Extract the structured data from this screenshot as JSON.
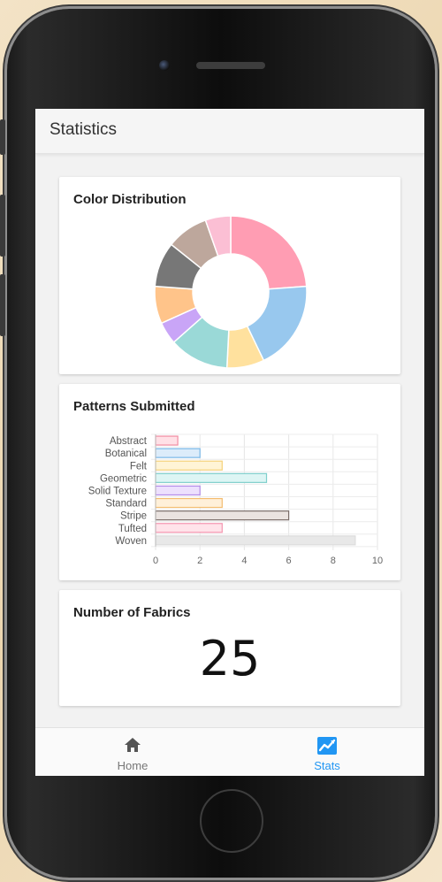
{
  "app": {
    "title": "Statistics"
  },
  "colors": {
    "accent": "#2196f3",
    "nav_inactive": "#777777",
    "pink": "#ff9db3",
    "blue": "#98c8ee",
    "yellow": "#ffe19e",
    "teal": "#9ad9d7",
    "purple": "#c9a5f7",
    "orange": "#ffc48a",
    "gray": "#777777",
    "taupe": "#bda79c",
    "light_pink": "#fbbfd4"
  },
  "color_card": {
    "title": "Color Distribution",
    "chart_data": {
      "type": "pie",
      "donut": true,
      "slices": [
        {
          "value": 7.5,
          "color": "#ff9db3"
        },
        {
          "value": 6.0,
          "color": "#98c8ee"
        },
        {
          "value": 2.5,
          "color": "#ffe19e"
        },
        {
          "value": 4.0,
          "color": "#9ad9d7"
        },
        {
          "value": 1.5,
          "color": "#c9a5f7"
        },
        {
          "value": 2.5,
          "color": "#ffc48a"
        },
        {
          "value": 3.0,
          "color": "#777777"
        },
        {
          "value": 2.8,
          "color": "#bda79c"
        },
        {
          "value": 1.7,
          "color": "#fbbfd4"
        }
      ]
    }
  },
  "patterns_card": {
    "title": "Patterns Submitted",
    "chart_data": {
      "type": "bar",
      "orientation": "horizontal",
      "categories": [
        "Abstract",
        "Botanical",
        "Felt",
        "Geometric",
        "Solid Texture",
        "Standard",
        "Stripe",
        "Tufted",
        "Woven"
      ],
      "values": [
        1,
        2,
        3,
        5,
        2,
        3,
        6,
        3,
        9
      ],
      "fills": [
        "#ffe0e6",
        "#dcecfa",
        "#fff4d6",
        "#ddf5f4",
        "#ede0fd",
        "#fff0d9",
        "#eae3e0",
        "#ffe3ea",
        "#e8e8e8"
      ],
      "strokes": [
        "#f28ca2",
        "#7ab8e8",
        "#f5d27a",
        "#7fcfcc",
        "#b28ae8",
        "#f3bc70",
        "#7a6d69",
        "#f495b0",
        "#dcdcdc"
      ],
      "xlim": [
        0,
        10
      ],
      "xticks": [
        0,
        2,
        4,
        6,
        8,
        10
      ],
      "grid": true
    }
  },
  "fabrics_card": {
    "title": "Number of Fabrics",
    "count": "25"
  },
  "bottom_nav": {
    "items": [
      {
        "label": "Home",
        "icon": "home-icon",
        "active": false
      },
      {
        "label": "Stats",
        "icon": "stats-icon",
        "active": true
      }
    ]
  }
}
